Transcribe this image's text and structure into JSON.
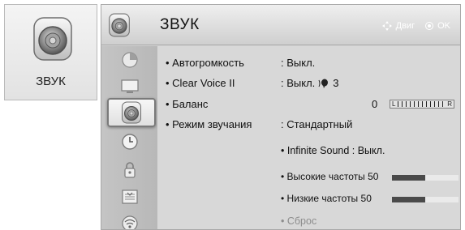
{
  "tile": {
    "label": "ЗВУК",
    "icon": "speaker-icon"
  },
  "header": {
    "title": "ЗВУК",
    "icon": "speaker-icon",
    "hint_move": "Двиг",
    "hint_ok": "OK",
    "hint_move_icon": "dpad-icon",
    "hint_ok_icon": "ok-circle-icon"
  },
  "sidebar": {
    "items": [
      {
        "name": "picture",
        "icon": "picture-icon"
      },
      {
        "name": "screen",
        "icon": "screen-icon"
      },
      {
        "name": "sound",
        "icon": "speaker-icon",
        "active": true
      },
      {
        "name": "time",
        "icon": "clock-icon"
      },
      {
        "name": "lock",
        "icon": "lock-icon"
      },
      {
        "name": "option",
        "icon": "option-icon"
      },
      {
        "name": "network",
        "icon": "network-icon"
      }
    ]
  },
  "settings": {
    "auto_volume": {
      "label": "• Автогромкость",
      "value": ": Выкл."
    },
    "clear_voice": {
      "label": "• Clear Voice II",
      "value": ": Выкл.",
      "level": "3"
    },
    "balance": {
      "label": "• Баланс",
      "value": "0",
      "left": "L",
      "right": "R"
    },
    "sound_mode": {
      "label": "• Режим звучания",
      "value": ": Стандартный"
    },
    "infinite_sound": {
      "text": "• Infinite Sound : Выкл."
    },
    "treble": {
      "label": "• Высокие частоты 50",
      "level": 0.5
    },
    "bass": {
      "label": "• Низкие частоты 50",
      "level": 0.5
    },
    "reset": {
      "label": "• Сброс"
    }
  },
  "colors": {
    "panel": "#d2d2d2",
    "bar_fill": "#4a4a4a",
    "active_border": "#7a7a7a",
    "disabled": "#8d8d8d"
  }
}
